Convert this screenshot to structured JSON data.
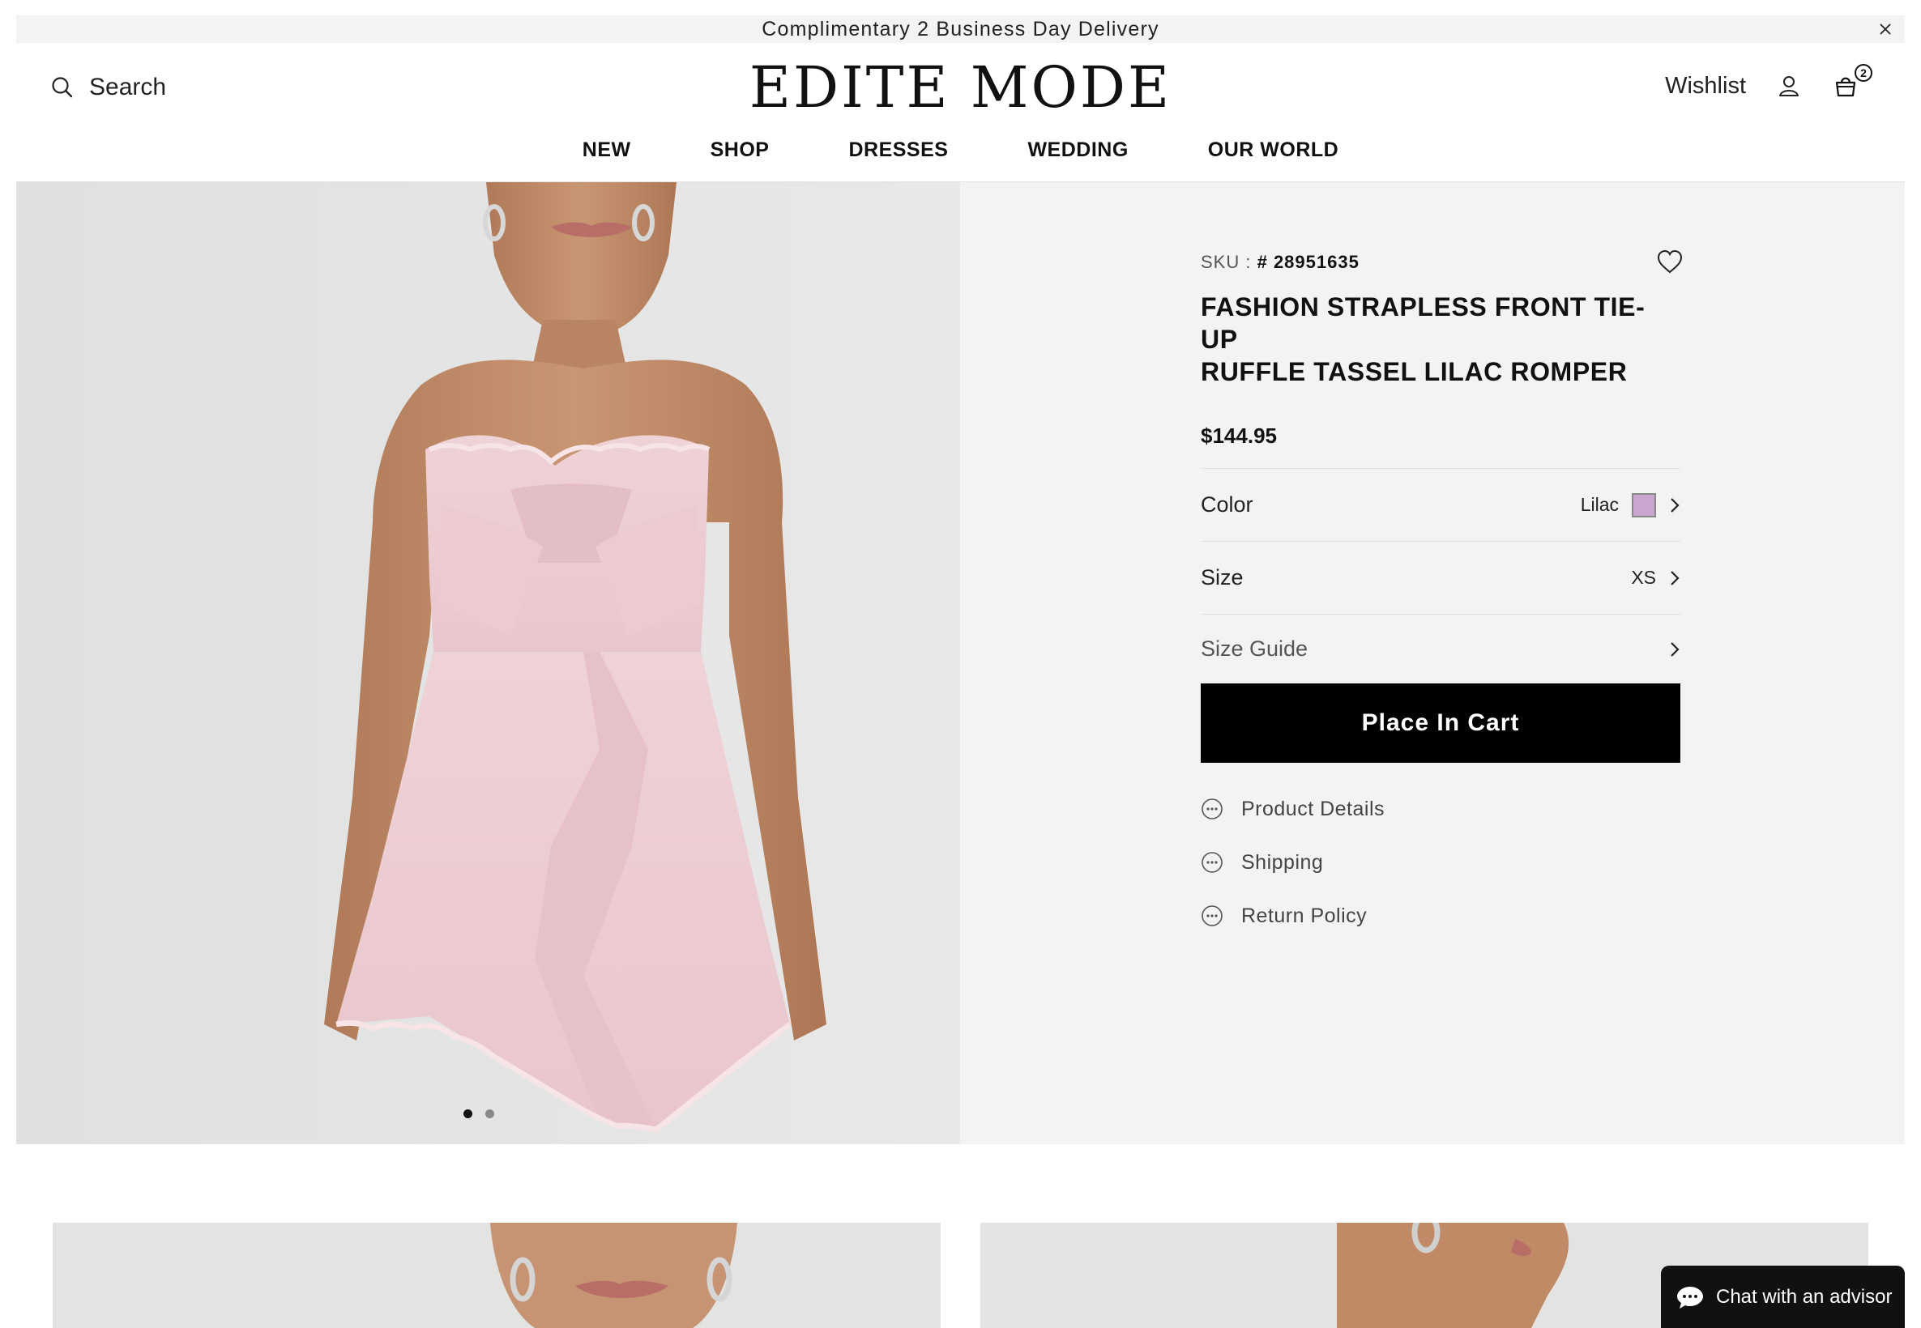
{
  "announcement": {
    "text": "Complimentary 2 Business Day Delivery"
  },
  "header": {
    "search_label": "Search",
    "logo": "EDITE MODE",
    "wishlist_label": "Wishlist",
    "cart_count": "2"
  },
  "nav": {
    "items": [
      {
        "label": "NEW"
      },
      {
        "label": "SHOP"
      },
      {
        "label": "DRESSES"
      },
      {
        "label": "WEDDING"
      },
      {
        "label": "OUR WORLD"
      }
    ]
  },
  "product": {
    "sku_label": "SKU :",
    "sku_value": "# 28951635",
    "title_line1": "FASHION STRAPLESS FRONT TIE-UP",
    "title_line2": "RUFFLE TASSEL LILAC ROMPER",
    "price": "$144.95",
    "color_label": "Color",
    "color_value": "Lilac",
    "color_swatch": "#c9a6cd",
    "size_label": "Size",
    "size_value": "XS",
    "size_guide_label": "Size Guide",
    "cart_button": "Place In Cart",
    "accordions": [
      {
        "label": "Product Details"
      },
      {
        "label": "Shipping"
      },
      {
        "label": "Return Policy"
      }
    ]
  },
  "gallery": {
    "slides": 2,
    "active_slide": 1
  },
  "chat": {
    "label": "Chat with an advisor"
  }
}
